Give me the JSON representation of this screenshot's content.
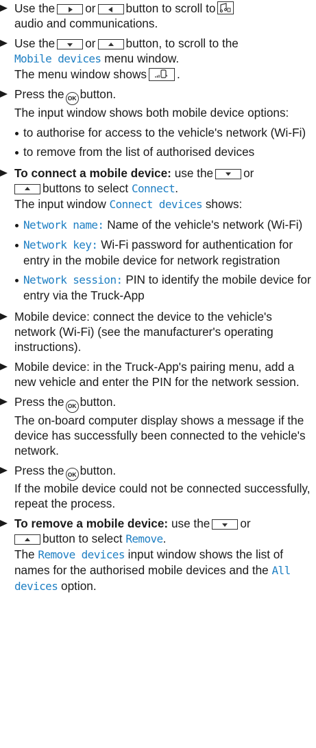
{
  "steps": [
    {
      "pre": "Use the",
      "or": "or",
      "post": "button to scroll to",
      "tail": "audio and communications."
    },
    {
      "pre": "Use the",
      "or": "or",
      "post": "button, to scroll to the",
      "menu": "Mobile devices",
      "post2": "menu window.",
      "line2": "The menu window shows",
      "line2end": "."
    },
    {
      "pre": "Press the",
      "post": "button.",
      "line2": "The input window shows both mobile device options:"
    },
    {
      "bold": "To connect a mobile device:",
      "pre": "use the",
      "or": "or",
      "post": "buttons to select",
      "sel": "Connect",
      "end": ".",
      "line2": "The input window",
      "win": "Connect devices",
      "line2post": "shows:"
    },
    {
      "text": "Mobile device: connect the device to the vehicle's network (Wi-Fi) (see the manufacturer's operating instructions)."
    },
    {
      "text": "Mobile device: in the Truck-App's pairing menu, add a new vehicle and enter the PIN for the network session."
    },
    {
      "pre": "Press the",
      "post": "button.",
      "line2": "The on-board computer display shows a message if the device has successfully been connected to the vehicle's network."
    },
    {
      "pre": "Press the",
      "post": "button.",
      "line2": "If the mobile device could not be connected successfully, repeat the process."
    },
    {
      "bold": "To remove a mobile device:",
      "pre": "use the",
      "or": "or",
      "post": "button to select",
      "sel": "Remove",
      "end": ".",
      "line2pre": "The",
      "win": "Remove devices",
      "line2post": "input window shows the list of names for the authorised mobile devices and the",
      "opt": "All devices",
      "optend": "option."
    }
  ],
  "options": [
    "to authorise for access to the vehicle's network (Wi-Fi)",
    "to remove from the list of authorised devices"
  ],
  "connect_items": [
    {
      "term": "Network name:",
      "desc": "Name of the vehicle's network (Wi-Fi)"
    },
    {
      "term": "Network key:",
      "desc": "Wi-Fi password for authentication for entry in the mobile device for network registration"
    },
    {
      "term": "Network session:",
      "desc": "PIN to identify the mobile device for entry via the Truck-App"
    }
  ],
  "ok_label": "OK",
  "icons": {
    "right": "arrow-right-key-icon",
    "left": "arrow-left-key-icon",
    "down": "arrow-down-key-icon",
    "up": "arrow-up-key-icon",
    "audio": "audio-communications-icon",
    "phone": "mobile-device-icon",
    "ok": "ok-button-icon"
  },
  "colors": {
    "accent": "#1e7fc3",
    "text": "#1a1a1a"
  }
}
